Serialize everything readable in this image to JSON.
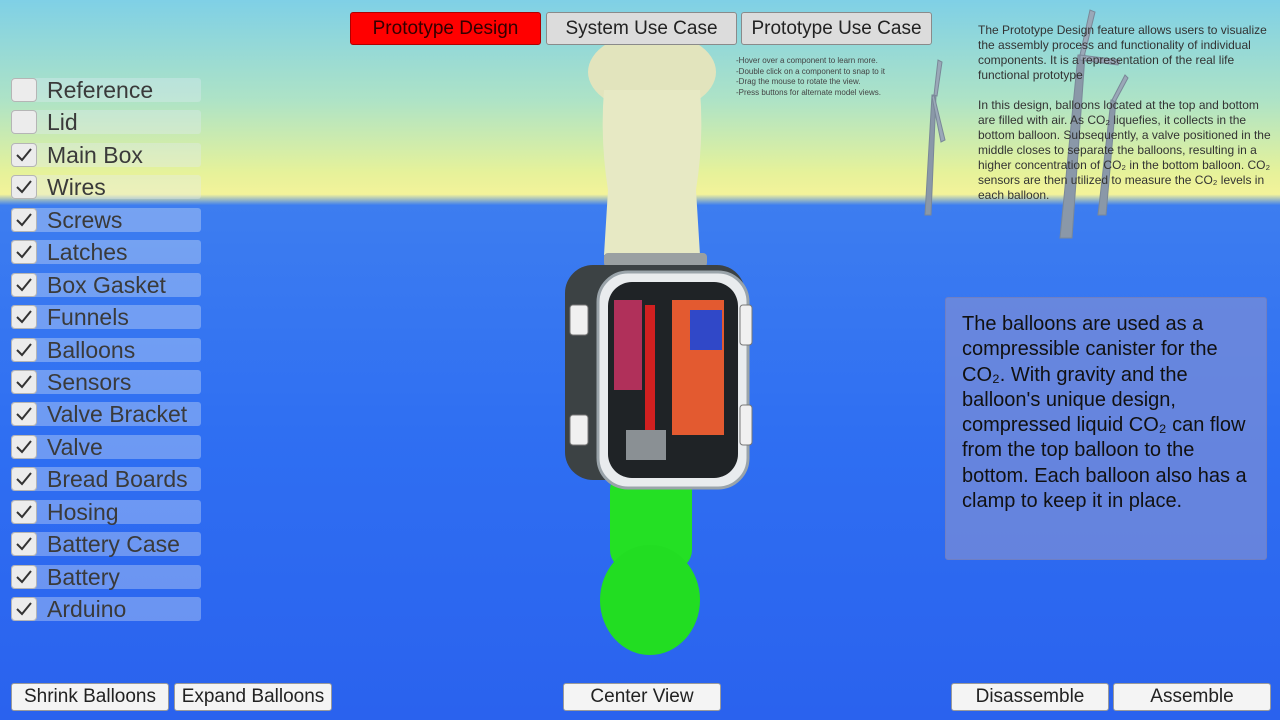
{
  "tabs": [
    {
      "label": "Prototype Design",
      "active": true
    },
    {
      "label": "System Use Case",
      "active": false
    },
    {
      "label": "Prototype Use Case",
      "active": false
    }
  ],
  "hints": "-Hover over a component to learn more.\n-Double click on a component to snap to it\n-Drag the mouse to rotate the view.\n-Press buttons for alternate model views.",
  "description": {
    "paragraph1": "The Prototype Design feature allows users to visualize the assembly process and functionality of individual components. It is a representation of the real life functional prototype",
    "paragraph2": "In this design, balloons located at the top and bottom are filled with air. As CO₂ liquefies, it collects in the bottom balloon. Subsequently, a valve positioned in the middle closes to separate the balloons, resulting in a higher concentration of CO₂ in the bottom balloon. CO₂ sensors are then utilized to measure the CO₂ levels in each balloon."
  },
  "components": [
    {
      "label": "Reference",
      "checked": false
    },
    {
      "label": "Lid",
      "checked": false
    },
    {
      "label": "Main Box",
      "checked": true
    },
    {
      "label": "Wires",
      "checked": true
    },
    {
      "label": "Screws",
      "checked": true
    },
    {
      "label": "Latches",
      "checked": true
    },
    {
      "label": "Box Gasket",
      "checked": true
    },
    {
      "label": "Funnels",
      "checked": true
    },
    {
      "label": "Balloons",
      "checked": true
    },
    {
      "label": "Sensors",
      "checked": true
    },
    {
      "label": "Valve Bracket",
      "checked": true
    },
    {
      "label": "Valve",
      "checked": true
    },
    {
      "label": "Bread Boards",
      "checked": true
    },
    {
      "label": "Hosing",
      "checked": true
    },
    {
      "label": "Battery Case",
      "checked": true
    },
    {
      "label": "Battery",
      "checked": true
    },
    {
      "label": "Arduino",
      "checked": true
    }
  ],
  "info_panel": "The balloons are used as a compressible canister for the CO₂. With gravity and the balloon's unique design, compressed liquid CO₂ can flow from the top balloon to the bottom. Each balloon also has a clamp to keep it in place.",
  "buttons": {
    "shrink": "Shrink Balloons",
    "expand": "Expand Balloons",
    "center": "Center View",
    "disassemble": "Disassemble",
    "assemble": "Assemble"
  },
  "colors": {
    "active_tab": "#ff0000",
    "top_balloon": "#e7e9c4",
    "bottom_balloon": "#22dd22",
    "sea": "#2f6ff2",
    "info_panel": "#7f8fd6"
  },
  "icons": [
    "checkmark-icon",
    "wind-turbine-icon"
  ]
}
